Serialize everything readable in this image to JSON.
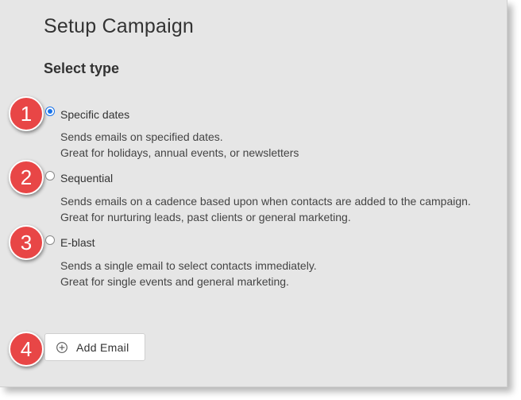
{
  "header": {
    "title": "Setup Campaign",
    "section_title": "Select type"
  },
  "options": [
    {
      "marker": "1",
      "label": "Specific dates",
      "selected": true,
      "desc_line1": "Sends emails on specified dates.",
      "desc_line2": "Great for holidays, annual events, or newsletters"
    },
    {
      "marker": "2",
      "label": "Sequential",
      "selected": false,
      "desc_line1": "Sends emails on a cadence based upon when contacts are added to the campaign.",
      "desc_line2": "Great for nurturing leads, past clients or general marketing."
    },
    {
      "marker": "3",
      "label": "E-blast",
      "selected": false,
      "desc_line1": "Sends a single email to select contacts immediately.",
      "desc_line2": "Great for single events and general marketing."
    }
  ],
  "add_email": {
    "marker": "4",
    "label": "Add Email",
    "icon": "plus-circle-icon"
  },
  "colors": {
    "marker": "#e84646",
    "radio_selected": "#1a73e8",
    "panel_bg": "#e6e6e6"
  }
}
